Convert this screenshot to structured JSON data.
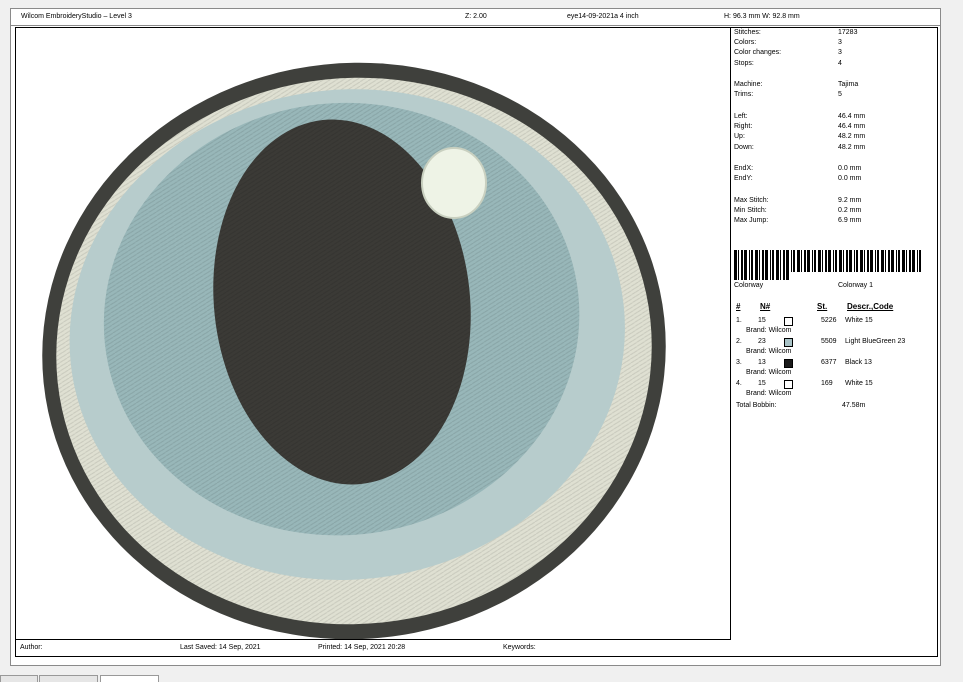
{
  "header": {
    "app_title": "Wilcom EmbroideryStudio – Level 3",
    "zoom": "Z: 2.00",
    "file_name": "eye14-09-2021a 4 inch",
    "dimensions": "H: 96.3 mm   W: 92.8 mm"
  },
  "stats": [
    {
      "key": "Stitches:",
      "value": "17283"
    },
    {
      "key": "Colors:",
      "value": "3"
    },
    {
      "key": "Color changes:",
      "value": "3"
    },
    {
      "key": "Stops:",
      "value": "4"
    },
    {
      "key": "Machine:",
      "value": "Tajima"
    },
    {
      "key": "Trims:",
      "value": "5"
    },
    {
      "key": "Left:",
      "value": "46.4 mm"
    },
    {
      "key": "Right:",
      "value": "46.4 mm"
    },
    {
      "key": "Up:",
      "value": "48.2 mm"
    },
    {
      "key": "Down:",
      "value": "48.2 mm"
    },
    {
      "key": "EndX:",
      "value": "0.0 mm"
    },
    {
      "key": "EndY:",
      "value": "0.0 mm"
    },
    {
      "key": "Max Stitch:",
      "value": "9.2 mm"
    },
    {
      "key": "Min Stitch:",
      "value": "0.2 mm"
    },
    {
      "key": "Max Jump:",
      "value": "6.9 mm"
    }
  ],
  "colorway": {
    "label": "Colorway",
    "value": "Colorway 1"
  },
  "color_table": {
    "headers": {
      "index": "#",
      "number": "N#",
      "stitches": "St.",
      "desc": "Descr.,Code"
    },
    "rows": [
      {
        "index": "1.",
        "number": "15",
        "swatch_color": "#ffffff",
        "stitches": "5226",
        "desc": "White 15",
        "brand": "Brand: Wilcom"
      },
      {
        "index": "2.",
        "number": "23",
        "swatch_color": "#a9c3c7",
        "stitches": "5509",
        "desc": "Light BlueGreen 23",
        "brand": "Brand: Wilcom"
      },
      {
        "index": "3.",
        "number": "13",
        "swatch_color": "#1a1a1a",
        "stitches": "6377",
        "desc": "Black 13",
        "brand": "Brand: Wilcom"
      },
      {
        "index": "4.",
        "number": "15",
        "swatch_color": "#ffffff",
        "stitches": "169",
        "desc": "White 15",
        "brand": "Brand: Wilcom"
      }
    ],
    "total_bobbin_label": "Total Bobbin:",
    "total_bobbin_value": "47.58m"
  },
  "footer": {
    "author": "Author:",
    "last_saved": "Last Saved: 14 Sep, 2021",
    "printed": "Printed: 14 Sep, 2021 20:28",
    "keywords": "Keywords:"
  },
  "colors": {
    "outer_ring": "#3f403c",
    "cream": "#dfe0d2",
    "pale_blue": "#b7cccc",
    "iris_blue": "#98b7b9",
    "pupil": "#3b3a36",
    "highlight": "#eef3e6"
  }
}
